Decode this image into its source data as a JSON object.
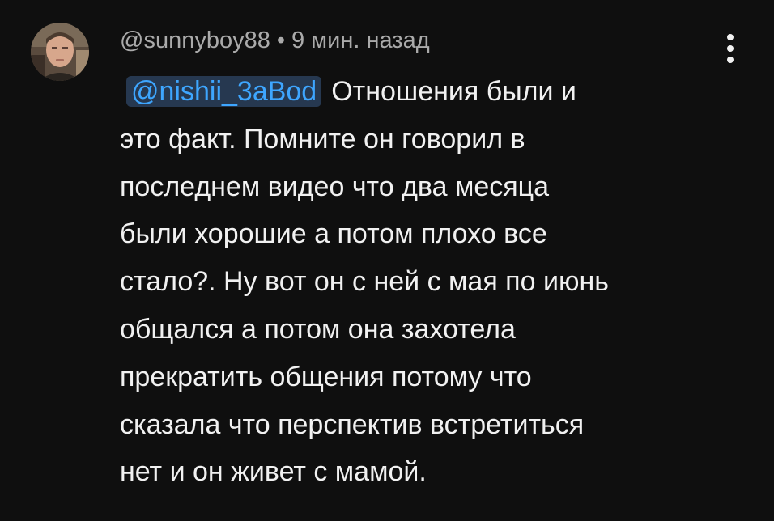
{
  "comment": {
    "author": "@sunnyboy88",
    "separator": "•",
    "timestamp": "9 мин. назад",
    "mention": "@nishii_3aBod",
    "text_lines": [
      "Отношения были и",
      "это факт. Помните он говорил в",
      "последнем видео что два месяца",
      "были хорошие а потом плохо все",
      "стало?. Ну вот он с ней с мая по июнь",
      "общался а потом она захотела",
      "прекратить общения потому что",
      "сказала что перспектив встретиться",
      "нет и он живет с мамой."
    ],
    "menu_icon": "more-vertical-icon",
    "colors": {
      "background": "#0f0f0f",
      "meta_text": "#aaaaaa",
      "body_text": "#f1f1f1",
      "mention_text": "#3ea6ff",
      "mention_bg": "#263850"
    }
  }
}
